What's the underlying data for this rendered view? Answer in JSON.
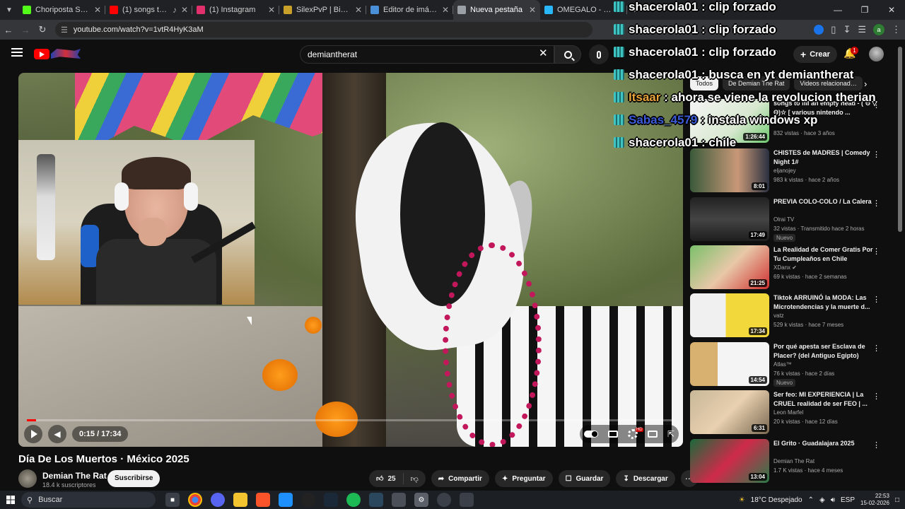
{
  "browser": {
    "tabs": [
      {
        "label": "Choriposta Stream - …",
        "fav_color": "#53fc18"
      },
      {
        "label": "(1) songs to fill an e…",
        "fav_color": "#ff0000",
        "audio": true
      },
      {
        "label": "(1) Instagram",
        "fav_color": "#e1306c"
      },
      {
        "label": "SilexPvP | Bienvenido",
        "fav_color": "#c8a02a"
      },
      {
        "label": "Editor de imágenes d…",
        "fav_color": "#4a90d9"
      },
      {
        "label": "Nueva pestaña",
        "fav_color": "#9aa0a6",
        "active": true
      },
      {
        "label": "OMEGALO - 7TV",
        "fav_color": "#29b6f6"
      }
    ],
    "url": "youtube.com/watch?v=1vtR4HyK3aM",
    "profile_initial": "a"
  },
  "youtube": {
    "search_value": "demiantherat",
    "create_label": "Crear",
    "notif_count": "1"
  },
  "player": {
    "time": "0:15 / 17:34",
    "progress": 0.014
  },
  "video": {
    "title": "Día De Los Muertos · México 2025",
    "channel": "Demian The Rat",
    "subs": "18.4 k suscriptores",
    "subscribe_label": "Suscribirse",
    "likes": "25",
    "share_label": "Compartir",
    "ask_label": "Preguntar",
    "save_label": "Guardar",
    "download_label": "Descargar"
  },
  "chips": [
    "Todos",
    "De Demian The Rat",
    "Videos relacionad…"
  ],
  "recommendations": [
    {
      "title": "songs to fill an empty head - (´ʘ ▽ ʘ)☆ [ various nintendo ...",
      "channel": "",
      "meta": "832 vistas · hace 3 años",
      "duration": "1:26:44",
      "thumb": "linear-gradient(135deg,#f4f4f4,#d8e8d0 60%,#6ec86e)"
    },
    {
      "title": "CHISTES de MADRES | Comedy Night 1#",
      "channel": "eljanojey",
      "meta": "983 k vistas · hace 2 años",
      "duration": "8:01",
      "thumb": "linear-gradient(90deg,#3a5a3a,#c89878 60%,#2a3040)"
    },
    {
      "title": "PREVIA COLO-COLO / La Calera",
      "channel": "Olrai TV",
      "meta": "32 vistas · Transmitido hace 2 horas",
      "badge": "Nuevo",
      "duration": "17:49",
      "thumb": "linear-gradient(180deg,#222,#444 50%,#1e1e1e)"
    },
    {
      "title": "La Realidad de Comer Gratis Por Tu Cumpleaños en Chile",
      "channel": "XDanx ✔",
      "meta": "69 k vistas · hace 2 semanas",
      "duration": "21:25",
      "thumb": "linear-gradient(135deg,#7bc06a,#e8c8a8 50%,#d03030)"
    },
    {
      "title": "Tiktok ARRUINÓ la MODA: Las Microtendencias y la muerte d...",
      "channel": "vatz",
      "meta": "529 k vistas · hace 7 meses",
      "duration": "17:34",
      "thumb": "linear-gradient(90deg,#f0f0f0 45%,#f2d83a 45%)"
    },
    {
      "title": "Por qué apesta ser Esclava de Placer? (del Antiguo Egipto)",
      "channel": "Atlas™",
      "meta": "76 k vistas · hace 2 días",
      "badge": "Nuevo",
      "duration": "14:54",
      "thumb": "linear-gradient(90deg,#d8b070 35%,#f4f4f4 35%)"
    },
    {
      "title": "Ser feo: MI EXPERIENCIA | La CRUEL realidad de ser FEO | ...",
      "channel": "Leon Marfel",
      "meta": "20 k vistas · hace 12 días",
      "duration": "6:31",
      "thumb": "linear-gradient(135deg,#c8b898,#e8d0b0 50%,#7a6850)"
    },
    {
      "title": "El Grito · Guadalajara 2025",
      "channel": "Demian The Rat",
      "meta": "1.7 K vistas · hace 4 meses",
      "duration": "13:04",
      "thumb": "linear-gradient(135deg,#1a6a3a,#d02a4a 50%,#2a7a4a)"
    }
  ],
  "chat": [
    {
      "user": "shacerola01",
      "msg": "clip forzado",
      "color": "#ffffff"
    },
    {
      "user": "shacerola01",
      "msg": "clip forzado",
      "color": "#ffffff"
    },
    {
      "user": "shacerola01",
      "msg": "clip forzado",
      "color": "#ffffff"
    },
    {
      "user": "shacerola01",
      "msg": "busca en yt demiantherat",
      "color": "#ffffff"
    },
    {
      "user": "Itsaar",
      "msg": "ahora se viene la revolucion therian",
      "color": "#e8a33a"
    },
    {
      "user": "Sabas_4579",
      "msg": "instala windows xp",
      "color": "#3a5ad8"
    },
    {
      "user": "shacerola01",
      "msg": "chile",
      "color": "#ffffff"
    }
  ],
  "taskbar": {
    "search_label": "Buscar",
    "weather": "18°C  Despejado",
    "lang": "ESP",
    "time": "22:53",
    "date": "15-02-2026"
  }
}
